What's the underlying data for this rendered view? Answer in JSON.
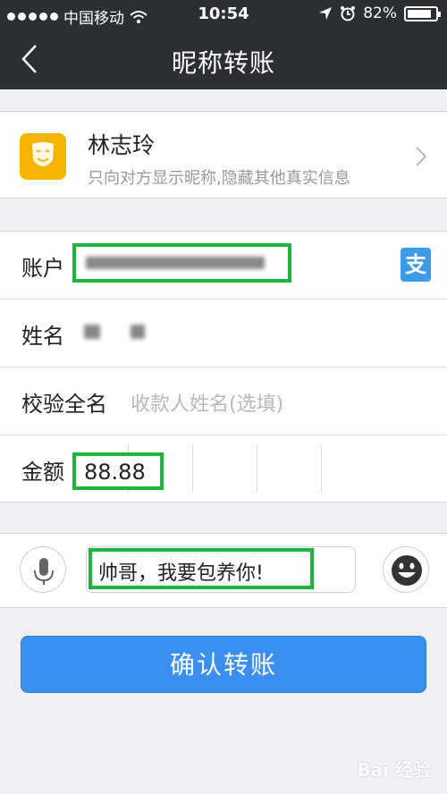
{
  "statusbar": {
    "carrier": "中国移动",
    "time": "10:54",
    "battery": "82%"
  },
  "nav": {
    "title": "昵称转账",
    "back_icon": "chevron-left-icon"
  },
  "recipient": {
    "name": "林志玲",
    "description": "只向对方显示昵称,隐藏其他真实信息",
    "avatar_color": "#f4b400"
  },
  "form": {
    "account_label": "账户",
    "name_label": "姓名",
    "verify_label": "校验全名",
    "verify_placeholder": "收款人姓名(选填)",
    "amount_label": "金额",
    "amount_value": "88.88"
  },
  "memo": {
    "text": "帅哥，我要包养你!"
  },
  "confirm_button": "确认转账",
  "watermark": "Bai 经验",
  "colors": {
    "highlight_green": "#1eb53a",
    "button_blue": "#3b8ff0",
    "nav_bg": "#2b2e33"
  }
}
